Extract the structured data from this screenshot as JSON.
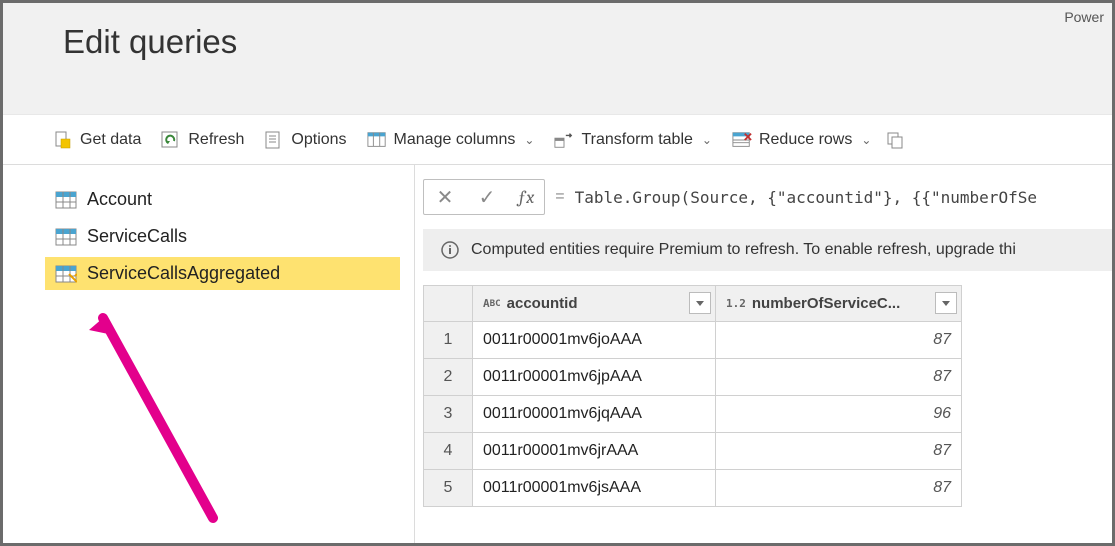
{
  "app_name": "Power",
  "page_title": "Edit queries",
  "toolbar": {
    "get_data": "Get data",
    "refresh": "Refresh",
    "options": "Options",
    "manage_columns": "Manage columns",
    "transform_table": "Transform table",
    "reduce_rows": "Reduce rows"
  },
  "queries": [
    {
      "name": "Account"
    },
    {
      "name": "ServiceCalls"
    },
    {
      "name": "ServiceCallsAggregated",
      "selected": true,
      "computed": true
    }
  ],
  "formula": "Table.Group(Source, {\"accountid\"}, {{\"numberOfSe",
  "notice": "Computed entities require Premium to refresh. To enable refresh, upgrade thi",
  "columns": [
    {
      "name": "accountid",
      "type_icon": "ABC"
    },
    {
      "name": "numberOfServiceC...",
      "type_icon": "1.2"
    }
  ],
  "rows": [
    {
      "idx": "1",
      "accountid": "0011r00001mv6joAAA",
      "numberOfServiceC": "87"
    },
    {
      "idx": "2",
      "accountid": "0011r00001mv6jpAAA",
      "numberOfServiceC": "87"
    },
    {
      "idx": "3",
      "accountid": "0011r00001mv6jqAAA",
      "numberOfServiceC": "96"
    },
    {
      "idx": "4",
      "accountid": "0011r00001mv6jrAAA",
      "numberOfServiceC": "87"
    },
    {
      "idx": "5",
      "accountid": "0011r00001mv6jsAAA",
      "numberOfServiceC": "87"
    }
  ]
}
